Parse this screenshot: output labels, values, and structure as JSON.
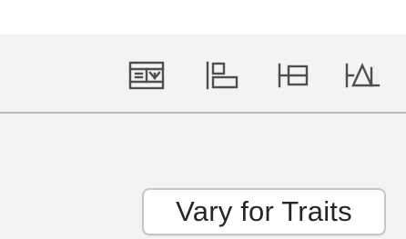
{
  "toolbar": {
    "icons": [
      {
        "name": "embed-in-stack-icon"
      },
      {
        "name": "align-icon"
      },
      {
        "name": "add-new-constraints-icon"
      },
      {
        "name": "resolve-auto-layout-issues-icon"
      }
    ]
  },
  "footer": {
    "vary_button_label": "Vary for Traits"
  },
  "colors": {
    "toolbar_bg": "#f3f3f3",
    "icon": "#4e4e4e",
    "divider": "#b9b9b9",
    "button_border": "#c6c6c6",
    "button_text": "#262626"
  }
}
